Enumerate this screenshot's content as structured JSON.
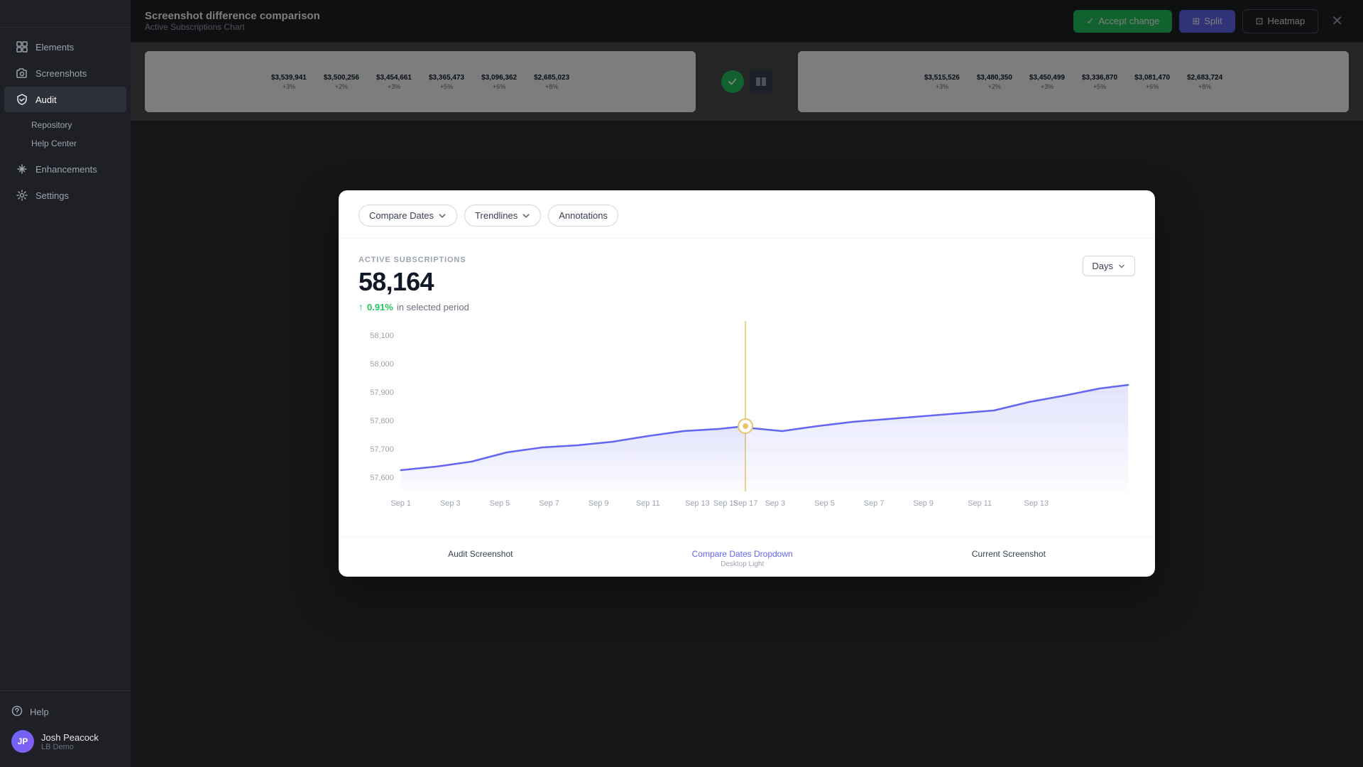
{
  "sidebar": {
    "logo": "Screenshot difference comparison",
    "nav_items": [
      {
        "id": "elements",
        "label": "Elements",
        "icon": "grid"
      },
      {
        "id": "screenshots",
        "label": "Screenshots",
        "icon": "camera"
      },
      {
        "id": "audit",
        "label": "Audit",
        "icon": "shield",
        "active": true
      },
      {
        "id": "enhancements",
        "label": "Enhancements",
        "icon": "sparkle"
      },
      {
        "id": "settings",
        "label": "Settings",
        "icon": "gear"
      }
    ],
    "sub_items": [
      {
        "label": "Repository"
      },
      {
        "label": "Help Center"
      }
    ],
    "help_label": "Help",
    "user": {
      "name": "Josh Peacock",
      "org": "LB Demo",
      "initials": "JP"
    }
  },
  "topbar": {
    "title": "Screenshot difference comparison",
    "subtitle": "Active Subscriptions Chart",
    "btn_accept": "Accept change",
    "btn_split": "Split",
    "btn_heatmap": "Heatmap"
  },
  "preview": {
    "left_numbers": [
      {
        "value": "$3,539,941",
        "change": "+3%"
      },
      {
        "value": "$3,500,256",
        "change": "+2%"
      },
      {
        "value": "$3,454,661",
        "change": "+3%"
      },
      {
        "value": "$3,365,473",
        "change": "+5%"
      },
      {
        "value": "$3,096,362",
        "change": "+6%"
      },
      {
        "value": "$2,685,023",
        "change": "+8%"
      }
    ],
    "right_numbers": [
      {
        "value": "$3,515,526",
        "change": "+3%"
      },
      {
        "value": "$3,480,350",
        "change": "+2%"
      },
      {
        "value": "$3,450,499",
        "change": "+3%"
      },
      {
        "value": "$3,336,870",
        "change": "+5%"
      },
      {
        "value": "$3,081,470",
        "change": "+6%"
      },
      {
        "value": "$2,683,724",
        "change": "+8%"
      }
    ]
  },
  "modal": {
    "toolbar": {
      "compare_dates_label": "Compare Dates",
      "trendlines_label": "Trendlines",
      "annotations_label": "Annotations"
    },
    "chart": {
      "section_label": "ACTIVE SUBSCRIPTIONS",
      "main_value": "58,164",
      "change_pct": "0.91%",
      "change_text": "in selected period",
      "period_dropdown": "Days",
      "y_labels": [
        "58,100",
        "58,000",
        "57,900",
        "57,800",
        "57,700",
        "57,600"
      ],
      "x_labels_left": [
        "Sep 1",
        "Sep 3",
        "Sep 5",
        "Sep 7",
        "Sep 9",
        "Sep 11",
        "Sep 13",
        "Sep 15",
        "Sep 17"
      ],
      "x_labels_right": [
        "Sep 3",
        "Sep 5",
        "Sep 7",
        "Sep 9",
        "Sep 11",
        "Sep 13"
      ]
    }
  },
  "footer": {
    "audit_label": "Audit Screenshot",
    "compare_label": "Compare Dates Dropdown",
    "compare_sub": "Desktop Light",
    "current_label": "Current Screenshot"
  }
}
